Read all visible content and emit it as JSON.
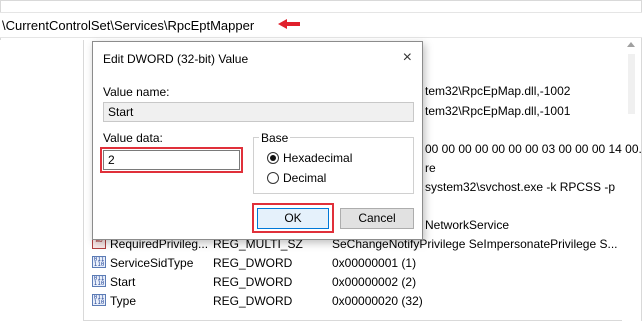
{
  "address": {
    "path": "\\CurrentControlSet\\Services\\RpcEptMapper"
  },
  "dialog": {
    "title": "Edit DWORD (32-bit) Value",
    "value_name_label": "Value name:",
    "value_name": "Start",
    "value_data_label": "Value data:",
    "value_data": "2",
    "base_label": "Base",
    "hex_label": "Hexadecimal",
    "dec_label": "Decimal",
    "selected_base": "Hexadecimal",
    "ok_label": "OK",
    "cancel_label": "Cancel",
    "close_glyph": "×"
  },
  "background": {
    "data_1": "tem32\\RpcEpMap.dll,-1002",
    "data_2": "tem32\\RpcEpMap.dll,-1001",
    "data_3": "00 00 00 00 00 00 00 03 00 00 00 14 00...",
    "data_4": "re",
    "data_5": "system32\\svchost.exe -k RPCSS -p",
    "data_6": "NetworkService"
  },
  "values": [
    {
      "icon": "reg-multi-sz-icon",
      "name": "RequiredPrivileg...",
      "type": "REG_MULTI_SZ",
      "data": "SeChangeNotifyPrivilege SeImpersonatePrivilege S..."
    },
    {
      "icon": "reg-dword-icon",
      "name": "ServiceSidType",
      "type": "REG_DWORD",
      "data": "0x00000001 (1)"
    },
    {
      "icon": "reg-dword-icon",
      "name": "Start",
      "type": "REG_DWORD",
      "data": "0x00000002 (2)"
    },
    {
      "icon": "reg-dword-icon",
      "name": "Type",
      "type": "REG_DWORD",
      "data": "0x00000020 (32)"
    }
  ],
  "colors": {
    "highlight": "#e0303a",
    "arrow": "#e0202c",
    "focus": "#0078d7"
  }
}
